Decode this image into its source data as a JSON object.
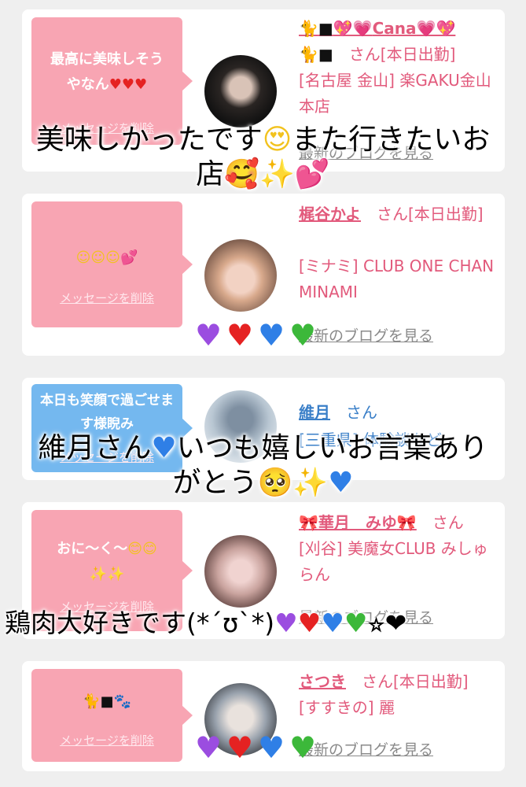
{
  "cards": [
    {
      "bubble_text": "最高に美味しそうやなん❤️❤️❤️",
      "delete_label": "メッセージを削除",
      "name": "🐈⬛💖💗Cana💗💖",
      "name2": "🐈⬛",
      "san": "さん[本日出勤]",
      "shop": "[名古屋 金山] 楽GAKU金山本店",
      "blog_label": "最新のブログを見る"
    },
    {
      "bubble_text": "☺️☺️☺️💕",
      "delete_label": "メッセージを削除",
      "name": "梶谷かよ",
      "san": "さん[本日出勤]",
      "shop": "[ミナミ] CLUB ONE CHAN MINAMI",
      "blog_label": "最新のブログを見る"
    },
    {
      "bubble_text": "本日も笑顔で過ごせます様睨み",
      "delete_label": "メッセージを削除",
      "name": "維月",
      "san": "さん",
      "shop": "[三重県] 体験談など"
    },
    {
      "bubble_text": "おに〜く〜😊😊✨✨",
      "delete_label": "メッセージを削除",
      "name": "🎀華月　みゆ🎀",
      "san": "さん",
      "shop": "[刈谷] 美魔女CLUB みしゅらん",
      "blog_label": "最新のブログを見る"
    },
    {
      "bubble_text": "🐈⬛🐾",
      "delete_label": "メッセージを削除",
      "name": "さつき",
      "san": "さん[本日出勤]",
      "shop": "[すすきの] 麗",
      "blog_label": "最新のブログを見る"
    }
  ],
  "overlays": {
    "caption1": "美味しかったです😍また行きたいお店🥰✨💕",
    "caption2": "維月さん💙いつも嬉しいお言葉ありがとう🥺✨💙",
    "caption3": "鶏肉大好きです(*´ʊ`*)💜❤️💙💚⭐︎❤",
    "hearts_row": "💜❤️💙💚"
  },
  "colors": {
    "bubble_pink": "#f8a5b3",
    "bubble_blue": "#74b8ef",
    "name_pink": "#e25a7c",
    "background": "#efefef"
  }
}
